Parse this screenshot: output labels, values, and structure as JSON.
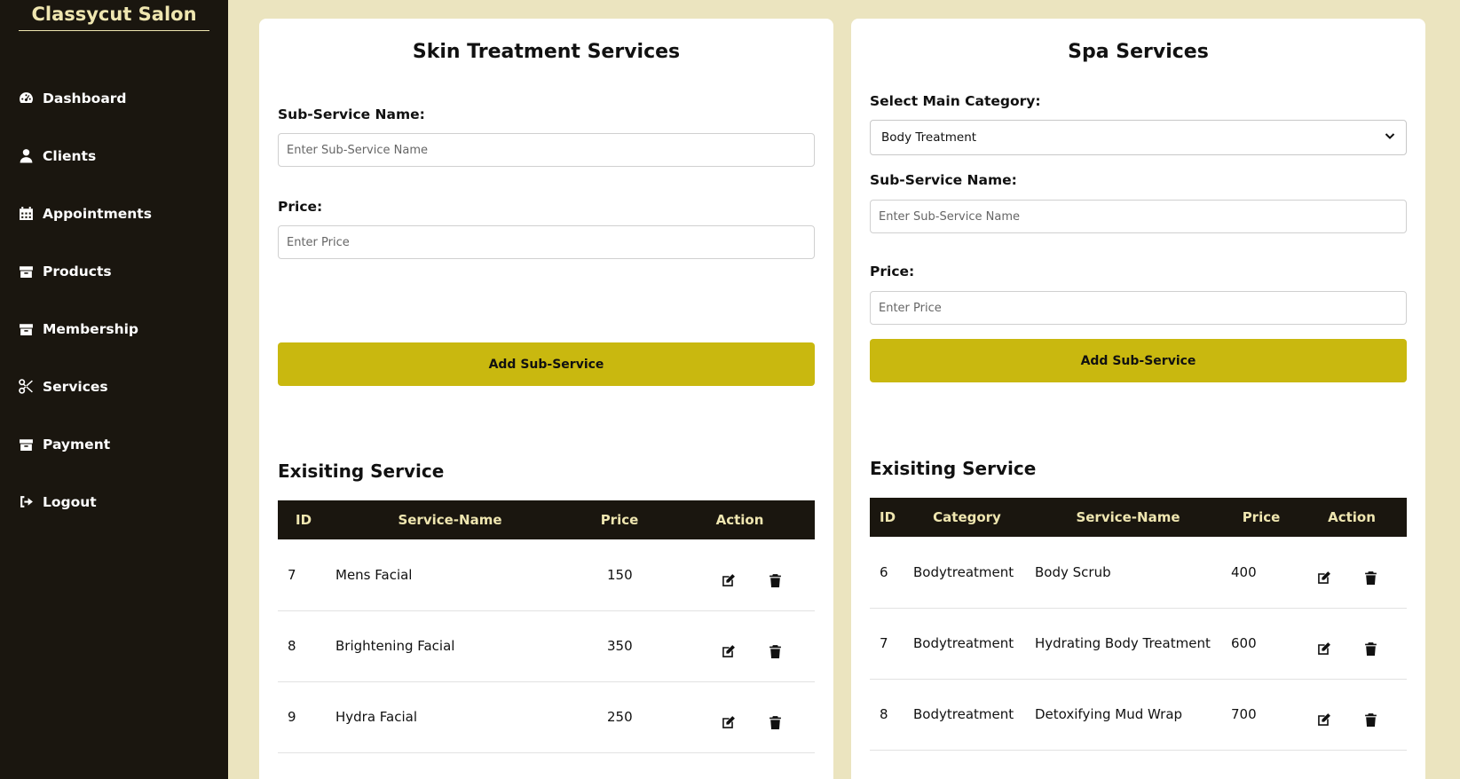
{
  "sidebar": {
    "brand": "Classycut Salon",
    "items": [
      {
        "label": "Dashboard",
        "icon": "gauge-icon"
      },
      {
        "label": "Clients",
        "icon": "user-icon"
      },
      {
        "label": "Appointments",
        "icon": "calendar-icon"
      },
      {
        "label": "Products",
        "icon": "box-icon"
      },
      {
        "label": "Membership",
        "icon": "box-icon"
      },
      {
        "label": "Services",
        "icon": "scissors-icon"
      },
      {
        "label": "Payment",
        "icon": "box-icon"
      },
      {
        "label": "Logout",
        "icon": "logout-icon"
      }
    ]
  },
  "skin": {
    "title": "Skin Treatment Services",
    "sub_service_label": "Sub-Service Name:",
    "sub_service_placeholder": "Enter Sub-Service Name",
    "price_label": "Price:",
    "price_placeholder": "Enter Price",
    "add_button": "Add Sub-Service",
    "existing_title": "Exisiting Service",
    "columns": [
      "ID",
      "Service-Name",
      "Price",
      "Action"
    ],
    "rows": [
      {
        "id": "7",
        "name": "Mens Facial",
        "price": "150"
      },
      {
        "id": "8",
        "name": "Brightening Facial",
        "price": "350"
      },
      {
        "id": "9",
        "name": "Hydra Facial",
        "price": "250"
      }
    ]
  },
  "spa": {
    "title": "Spa Services",
    "category_label": "Select Main Category:",
    "category_selected": "Body Treatment",
    "sub_service_label": "Sub-Service Name:",
    "sub_service_placeholder": "Enter Sub-Service Name",
    "price_label": "Price:",
    "price_placeholder": "Enter Price",
    "add_button": "Add Sub-Service",
    "existing_title": "Exisiting Service",
    "columns": [
      "ID",
      "Category",
      "Service-Name",
      "Price",
      "Action"
    ],
    "rows": [
      {
        "id": "6",
        "category": "Bodytreatment",
        "name": "Body Scrub",
        "price": "400"
      },
      {
        "id": "7",
        "category": "Bodytreatment",
        "name": "Hydrating Body Treatment",
        "price": "600"
      },
      {
        "id": "8",
        "category": "Bodytreatment",
        "name": "Detoxifying Mud Wrap",
        "price": "700"
      }
    ]
  },
  "colors": {
    "sidebar_bg": "#1a160f",
    "page_bg": "#ebe4bf",
    "accent": "#c9b80f",
    "header_text": "#efe6b0"
  }
}
